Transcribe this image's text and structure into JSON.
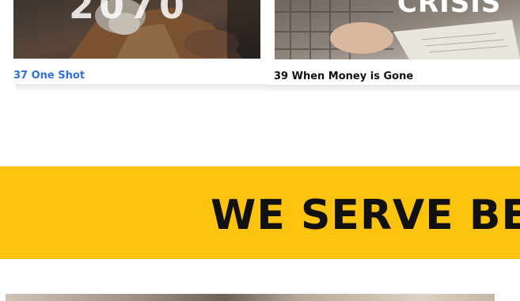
{
  "cards": [
    {
      "title": "37 One Shot",
      "image_text": "2070",
      "title_color": "#2f6fe0"
    },
    {
      "title": "39 When Money is Gone",
      "image_text": "CRISIS",
      "title_color": "#111111"
    }
  ],
  "banner": {
    "text": "WE SERVE BEC",
    "background": "#fcc40f"
  }
}
